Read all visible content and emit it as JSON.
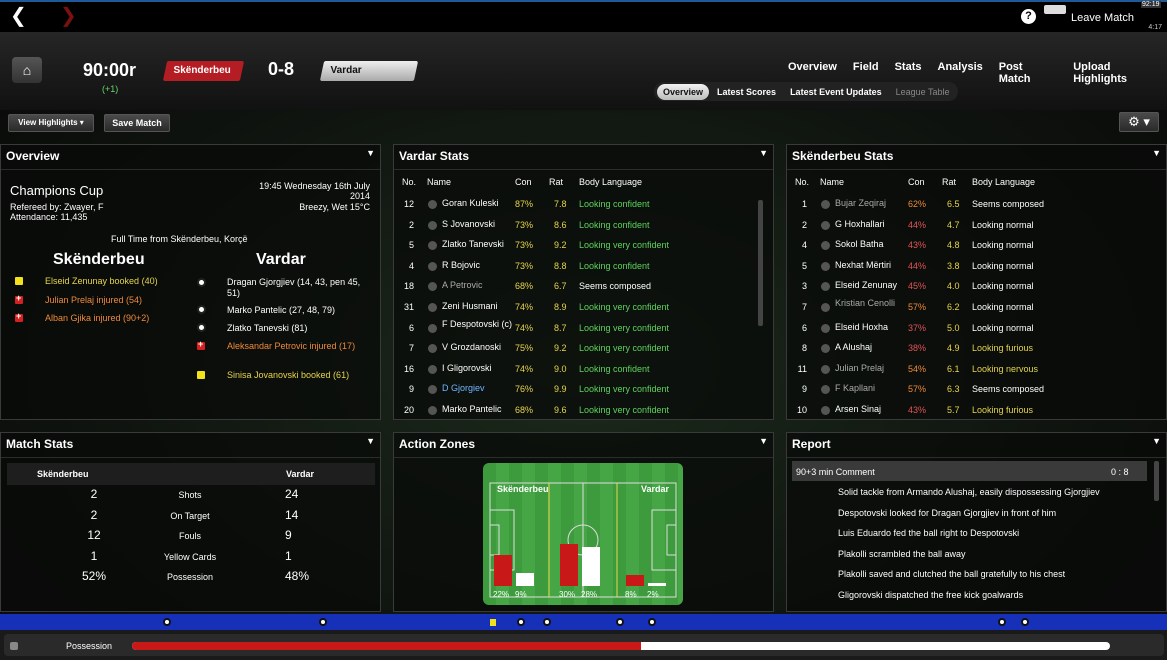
{
  "top": {
    "back_icon": "back-arrow",
    "help": "?",
    "leave_label": "Leave Match",
    "clock": "4:17"
  },
  "header": {
    "clock": "90:00r",
    "added": "(+1)",
    "home_team": "Skënderbeu",
    "score": "0-8",
    "away_team": "Vardar",
    "main_nav": [
      "Overview",
      "Field",
      "Stats",
      "Analysis",
      "Post Match",
      "Upload Highlights"
    ],
    "sub_nav": [
      "Overview",
      "Latest Scores",
      "Latest Event Updates",
      "League Table"
    ]
  },
  "actions": {
    "view_highlights": "View Highlights ▾",
    "save_match": "Save Match"
  },
  "overview": {
    "title": "Overview",
    "competition": "Champions Cup",
    "datetime_line1": "19:45 Wednesday 16th July",
    "datetime_line2": "2014",
    "weather": "Breezy, Wet 15°C",
    "referee": "Refereed by: Zwayer, F",
    "attendance": "Attendance: 11,435",
    "result": "Full Time from Skënderbeu, Korçë",
    "home_team": "Skënderbeu",
    "away_team": "Vardar",
    "home_events": [
      {
        "type": "yellow",
        "text": "Elseid Zenunay booked (40)"
      },
      {
        "type": "injury",
        "text": "Julian Prelaj injured (54)"
      },
      {
        "type": "injury",
        "text": "Alban Gjika injured (90+2)"
      }
    ],
    "away_events": [
      {
        "type": "goal",
        "text": "Dragan Gjorgjiev (14, 43, pen 45, 51)"
      },
      {
        "type": "goal",
        "text": "Marko Pantelic (27, 48, 79)"
      },
      {
        "type": "goal",
        "text": "Zlatko Tanevski (81)"
      },
      {
        "type": "injury",
        "text": "Aleksandar Petrovic injured (17)"
      },
      {
        "type": "yellow",
        "text": "Sinisa Jovanovski booked (61)"
      }
    ]
  },
  "vardar_stats": {
    "title": "Vardar Stats",
    "headers": [
      "No.",
      "Name",
      "Con",
      "Rat",
      "Body Language"
    ],
    "rows": [
      {
        "no": "12",
        "name": "Goran Kuleski",
        "con": "87%",
        "rat": "7.8",
        "body": "Looking confident",
        "nc": "wht",
        "cc": "yel",
        "bc": "green"
      },
      {
        "no": "2",
        "name": "S Jovanovski",
        "con": "73%",
        "rat": "8.6",
        "body": "Looking confident",
        "nc": "wht",
        "cc": "yel",
        "bc": "green"
      },
      {
        "no": "5",
        "name": "Zlatko Tanevski",
        "con": "73%",
        "rat": "9.2",
        "body": "Looking very confident",
        "nc": "wht",
        "cc": "yel",
        "bc": "green"
      },
      {
        "no": "4",
        "name": "R Bojovic",
        "con": "73%",
        "rat": "8.8",
        "body": "Looking confident",
        "nc": "wht",
        "cc": "yel",
        "bc": "green"
      },
      {
        "no": "18",
        "name": "A Petrovic",
        "con": "68%",
        "rat": "6.7",
        "body": "Seems composed",
        "nc": "gry",
        "cc": "yel",
        "bc": "wht"
      },
      {
        "no": "31",
        "name": "Zeni Husmani",
        "con": "74%",
        "rat": "8.9",
        "body": "Looking very confident",
        "nc": "wht",
        "cc": "yel",
        "bc": "green"
      },
      {
        "no": "6",
        "name": "F Despotovski (c)",
        "con": "74%",
        "rat": "8.7",
        "body": "Looking very confident",
        "nc": "wht",
        "cc": "yel",
        "bc": "green"
      },
      {
        "no": "7",
        "name": "V Grozdanoski",
        "con": "75%",
        "rat": "9.2",
        "body": "Looking very confident",
        "nc": "wht",
        "cc": "yel",
        "bc": "green"
      },
      {
        "no": "16",
        "name": "I Gligorovski",
        "con": "74%",
        "rat": "9.0",
        "body": "Looking confident",
        "nc": "wht",
        "cc": "yel",
        "bc": "green"
      },
      {
        "no": "9",
        "name": "D Gjorgiev",
        "con": "76%",
        "rat": "9.9",
        "body": "Looking very confident",
        "nc": "blu",
        "cc": "yel",
        "bc": "green"
      },
      {
        "no": "20",
        "name": "Marko Pantelic",
        "con": "68%",
        "rat": "9.6",
        "body": "Looking very confident",
        "nc": "wht",
        "cc": "yel",
        "bc": "green"
      }
    ]
  },
  "sk_stats": {
    "title": "Skënderbeu Stats",
    "headers": [
      "No.",
      "Name",
      "Con",
      "Rat",
      "Body Language"
    ],
    "rows": [
      {
        "no": "1",
        "name": "Bujar Zeqiraj",
        "con": "62%",
        "rat": "6.5",
        "body": "Seems composed",
        "nc": "gry",
        "cc": "ora",
        "bc": "wht"
      },
      {
        "no": "2",
        "name": "G Hoxhallari",
        "con": "44%",
        "rat": "4.7",
        "body": "Looking normal",
        "nc": "wht",
        "cc": "red",
        "bc": "wht"
      },
      {
        "no": "4",
        "name": "Sokol Batha",
        "con": "43%",
        "rat": "4.8",
        "body": "Looking normal",
        "nc": "wht",
        "cc": "red",
        "bc": "wht"
      },
      {
        "no": "5",
        "name": "Nexhat Mërtiri",
        "con": "44%",
        "rat": "3.8",
        "body": "Looking normal",
        "nc": "wht",
        "cc": "red",
        "bc": "wht"
      },
      {
        "no": "3",
        "name": "Elseid Zenunay",
        "con": "45%",
        "rat": "4.0",
        "body": "Looking normal",
        "nc": "wht",
        "cc": "red",
        "bc": "wht"
      },
      {
        "no": "7",
        "name": "Kristian Cenolli",
        "con": "57%",
        "rat": "6.2",
        "body": "Looking normal",
        "nc": "gry",
        "cc": "ora",
        "bc": "wht"
      },
      {
        "no": "6",
        "name": "Elseid Hoxha",
        "con": "37%",
        "rat": "5.0",
        "body": "Looking normal",
        "nc": "wht",
        "cc": "red",
        "bc": "wht"
      },
      {
        "no": "8",
        "name": "A Alushaj",
        "con": "38%",
        "rat": "4.9",
        "body": "Looking furious",
        "nc": "wht",
        "cc": "red",
        "bc": "yel"
      },
      {
        "no": "11",
        "name": "Julian Prelaj",
        "con": "54%",
        "rat": "6.1",
        "body": "Looking nervous",
        "nc": "gry",
        "cc": "ora",
        "bc": "yel"
      },
      {
        "no": "9",
        "name": "F Kapllani",
        "con": "57%",
        "rat": "6.3",
        "body": "Seems composed",
        "nc": "gry",
        "cc": "ora",
        "bc": "wht"
      },
      {
        "no": "10",
        "name": "Arsen Sinaj",
        "con": "43%",
        "rat": "5.7",
        "body": "Looking furious",
        "nc": "wht",
        "cc": "red",
        "bc": "yel"
      }
    ]
  },
  "match_stats": {
    "title": "Match Stats",
    "home": "Skënderbeu",
    "away": "Vardar",
    "rows": [
      {
        "home": "2",
        "label": "Shots",
        "away": "24"
      },
      {
        "home": "2",
        "label": "On Target",
        "away": "14"
      },
      {
        "home": "12",
        "label": "Fouls",
        "away": "9"
      },
      {
        "home": "1",
        "label": "Yellow Cards",
        "away": "1"
      },
      {
        "home": "52%",
        "label": "Possession",
        "away": "48%"
      }
    ]
  },
  "action_zones": {
    "title": "Action Zones",
    "home": "Skënderbeu",
    "away": "Vardar",
    "zones": [
      {
        "home": 22,
        "away": 9,
        "home_label": "22%",
        "away_label": "9%"
      },
      {
        "home": 30,
        "away": 28,
        "home_label": "30%",
        "away_label": "28%"
      },
      {
        "home": 8,
        "away": 2,
        "home_label": "8%",
        "away_label": "2%"
      }
    ]
  },
  "report": {
    "title": "Report",
    "header_left": "90+3 min Comment",
    "header_right": "0 : 8",
    "lines": [
      "Solid tackle from Armando Alushaj, easily dispossessing Gjorgjiev",
      "Despotovski looked for Dragan Gjorgjiev in front of him",
      "Luis Eduardo fed the ball right to Despotovski",
      "Plakolli scrambled the ball away",
      "Plakolli saved and clutched the ball gratefully to his chest",
      "Gligorovski dispatched the free kick goalwards"
    ]
  },
  "timeline": {
    "end_label": "92:19",
    "possession_label": "Possession",
    "home_possession": 0.52
  }
}
